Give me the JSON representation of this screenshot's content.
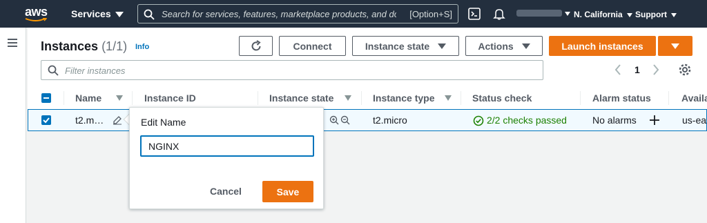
{
  "topnav": {
    "logo": "aws",
    "services_label": "Services",
    "search_placeholder": "Search for services, features, marketplace products, and docs",
    "search_shortcut": "[Option+S]",
    "region": "N. California",
    "support": "Support"
  },
  "header": {
    "title": "Instances",
    "count": "(1/1)",
    "info": "Info",
    "connect": "Connect",
    "instance_state": "Instance state",
    "actions": "Actions",
    "launch": "Launch instances"
  },
  "filter": {
    "placeholder": "Filter instances"
  },
  "pagination": {
    "page": "1"
  },
  "table": {
    "columns": [
      "Name",
      "Instance ID",
      "Instance state",
      "Instance type",
      "Status check",
      "Alarm status",
      "Availability Zone"
    ],
    "row": {
      "name": "t2.m…",
      "instance_type": "t2.micro",
      "status_check": "2/2 checks passed",
      "alarm_status": "No alarms",
      "zone": "us-eas"
    }
  },
  "popover": {
    "title": "Edit Name",
    "value": "NGINX",
    "cancel": "Cancel",
    "save": "Save"
  },
  "colors": {
    "nav_bg": "#232f3e",
    "accent": "#ec7211",
    "link": "#0073bb",
    "success": "#1d8102"
  }
}
